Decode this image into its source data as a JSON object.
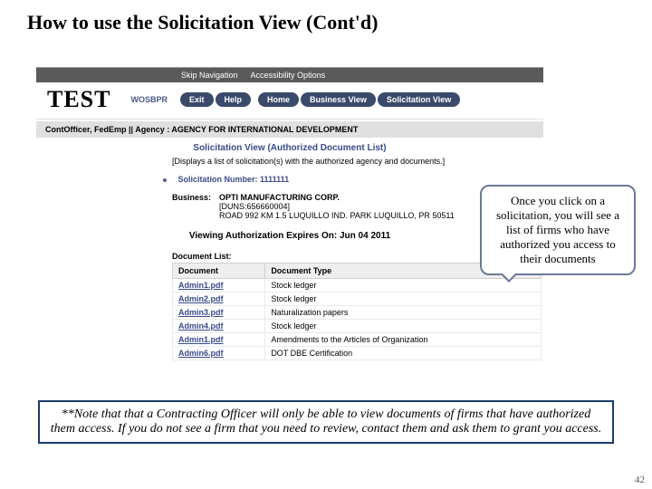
{
  "slide": {
    "title": "How to use the Solicitation View (Cont'd)",
    "number": "42"
  },
  "topbar": {
    "skip": "Skip Navigation",
    "access": "Accessibility Options"
  },
  "header": {
    "logo": "TEST",
    "brand": "WOSBPR",
    "pills": {
      "exit": "Exit",
      "help": "Help",
      "home": "Home",
      "biz": "Business View",
      "sol": "Solicitation View"
    }
  },
  "agency_line": "ContOfficer, FedEmp || Agency : AGENCY FOR INTERNATIONAL DEVELOPMENT",
  "view_title": "Solicitation View (Authorized Document List)",
  "view_desc": "[Displays a list of solicitation(s) with the authorized agency and documents.]",
  "solicitation": {
    "label": "Solicitation Number:",
    "value": "1111111"
  },
  "business": {
    "label": "Business:",
    "name": "OPTI MANUFACTURING CORP.",
    "duns": "[DUNS:656660004]",
    "addr": "ROAD 992 KM 1.5 LUQUILLO IND. PARK LUQUILLO, PR 50511"
  },
  "expires": "Viewing Authorization Expires On: Jun 04 2011",
  "doclist_label": "Document List:",
  "table": {
    "col_doc": "Document",
    "col_type": "Document Type",
    "rows": [
      {
        "doc": "Admin1.pdf",
        "type": "Stock ledger"
      },
      {
        "doc": "Admin2.pdf",
        "type": "Stock ledger"
      },
      {
        "doc": "Admin3.pdf",
        "type": "Naturalization papers"
      },
      {
        "doc": "Admin4.pdf",
        "type": "Stock ledger"
      },
      {
        "doc": "Admin1.pdf",
        "type": "Amendments to the Articles of Organization"
      },
      {
        "doc": "Admin6.pdf",
        "type": "DOT DBE Certification"
      }
    ]
  },
  "callout": "Once you click on a solicitation, you will see a list of firms who have authorized you access to their documents",
  "note": "**Note that that a Contracting Officer will only be able to view documents of firms that have authorized them access.  If you do not see a firm that you need to review, contact them and ask them to grant you access."
}
